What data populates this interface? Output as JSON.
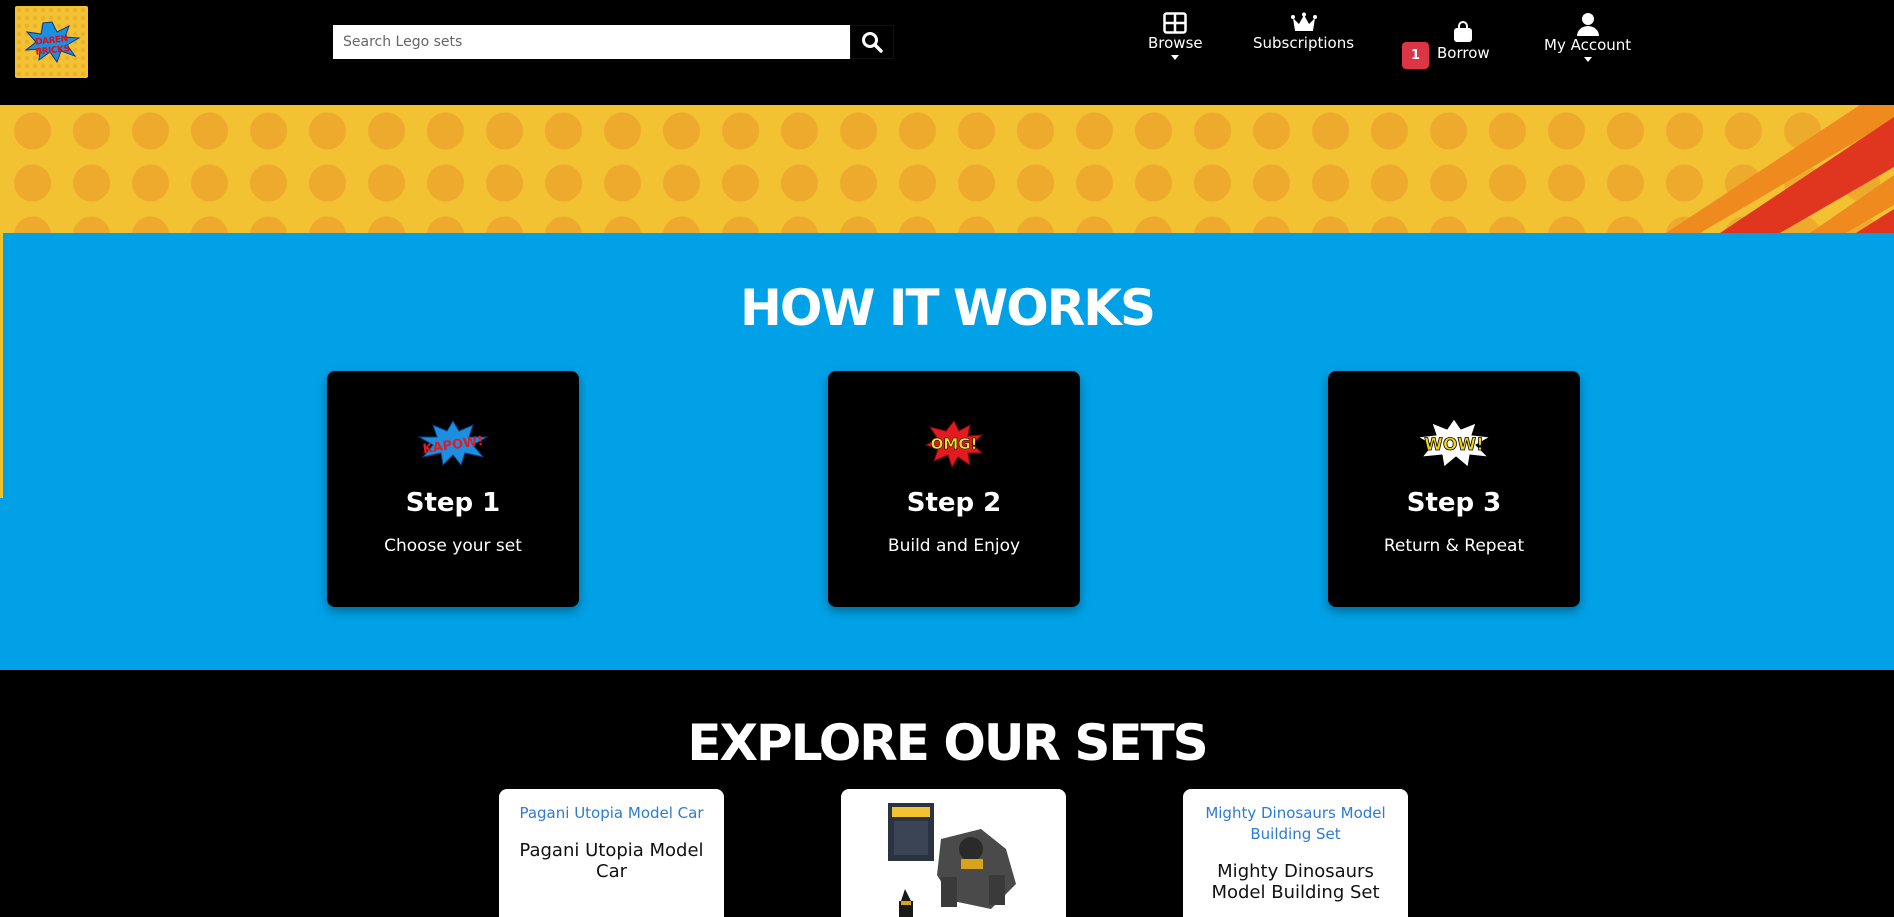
{
  "header": {
    "logo_text": "DAREN BRICKS",
    "search": {
      "placeholder": "Search Lego sets",
      "value": ""
    },
    "nav": {
      "browse": "Browse",
      "subscriptions": "Subscriptions",
      "borrow": "Borrow",
      "borrow_count": "1",
      "my_account": "My Account"
    }
  },
  "how_it_works": {
    "title": "HOW IT WORKS",
    "steps": [
      {
        "title": "Step 1",
        "desc": "Choose your set",
        "icon": "kapow-burst-icon"
      },
      {
        "title": "Step 2",
        "desc": "Build and Enjoy",
        "icon": "omg-burst-icon"
      },
      {
        "title": "Step 3",
        "desc": "Return & Repeat",
        "icon": "wow-burst-icon"
      }
    ]
  },
  "explore": {
    "title": "EXPLORE OUR SETS",
    "sets": [
      {
        "img_alt": "Pagani Utopia Model Car",
        "name": "Pagani Utopia Model Car"
      },
      {
        "img_alt": "",
        "name": ""
      },
      {
        "img_alt": "Mighty Dinosaurs Model Building Set",
        "name": "Mighty Dinosaurs Model Building Set"
      }
    ]
  },
  "colors": {
    "yellow": "#f2c232",
    "blue": "#00a1e6",
    "red": "#dc3545",
    "black": "#000000"
  }
}
